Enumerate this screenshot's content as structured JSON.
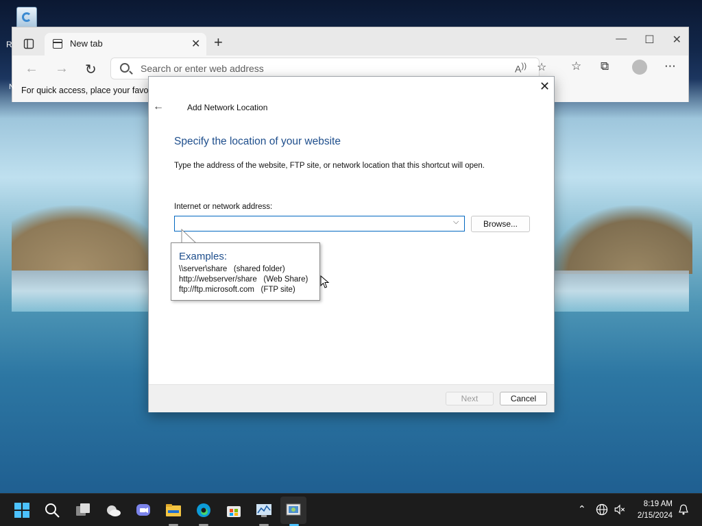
{
  "desktop": {
    "recycle_bin_label_fragment": "R",
    "recycle_bin_label_fragment2": "N"
  },
  "browser": {
    "tab_title": "New tab",
    "address_placeholder": "Search or enter web address",
    "favorites_bar_text": "For quick access, place your favori"
  },
  "dialog": {
    "window_title": "Add Network Location",
    "heading": "Specify the location of your website",
    "description": "Type the address of the website, FTP site, or network location that this shortcut will open.",
    "field_label": "Internet or network address:",
    "field_value": "",
    "browse_label": "Browse...",
    "next_label": "Next",
    "cancel_label": "Cancel"
  },
  "tooltip": {
    "title": "Examples:",
    "lines": [
      "\\\\server\\share   (shared folder)",
      "http://webserver/share   (Web Share)",
      "ftp://ftp.microsoft.com   (FTP site)"
    ]
  },
  "taskbar": {
    "time": "8:19 AM",
    "date": "2/15/2024",
    "accent": "#4cc2ff"
  }
}
